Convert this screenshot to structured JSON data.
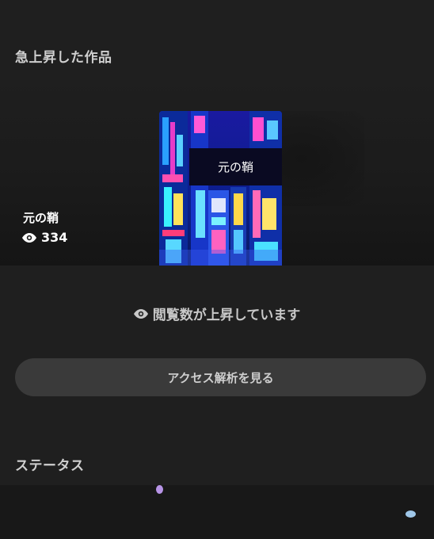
{
  "sections": {
    "rising_title": "急上昇した作品",
    "status_title": "ステータス"
  },
  "work": {
    "title": "元の鞘",
    "views": "334",
    "cover_title": "元の鞘"
  },
  "rising_note": "閲覧数が上昇しています",
  "analytics_button": "アクセス解析を見る",
  "icons": {
    "views": "eye-icon",
    "note": "eye-icon"
  }
}
